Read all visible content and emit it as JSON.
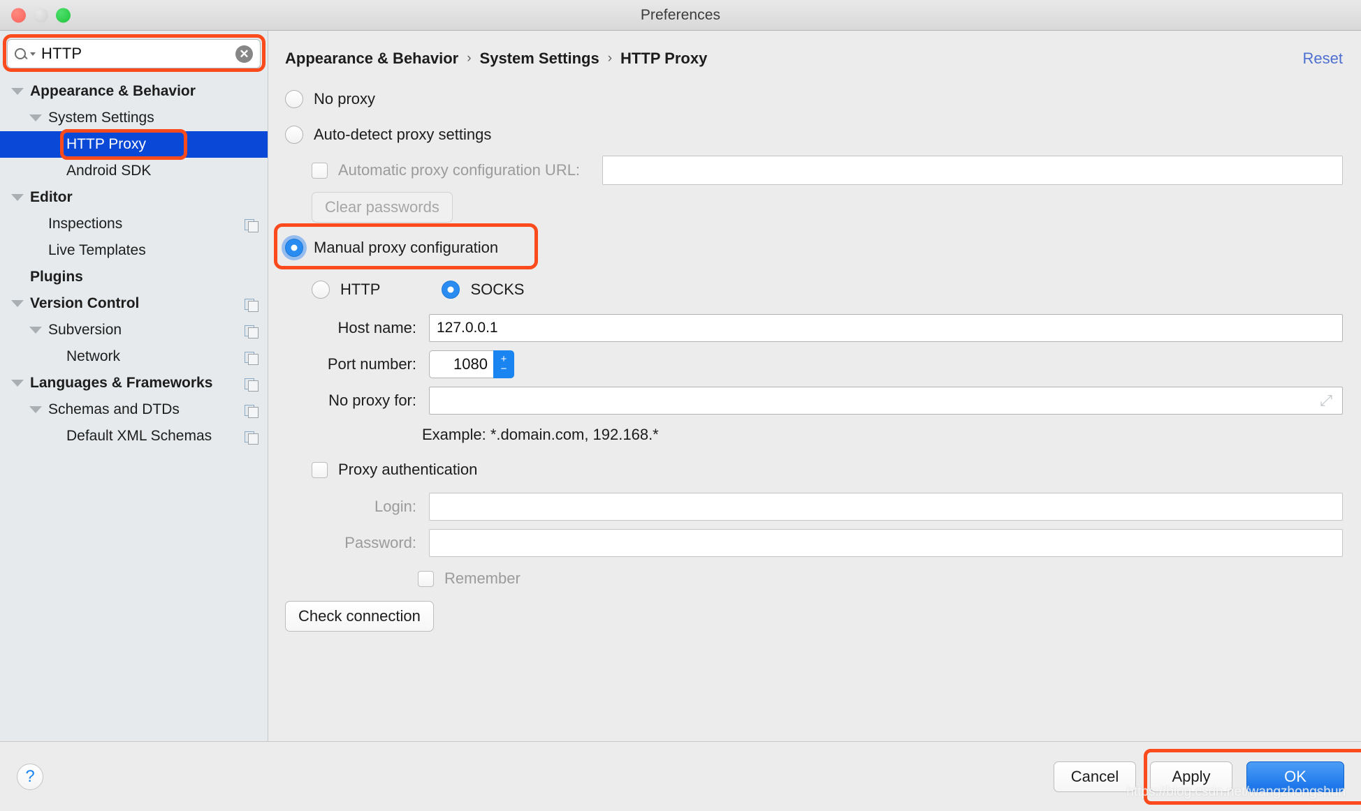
{
  "window": {
    "title": "Preferences",
    "traffic_lights": [
      "close",
      "minimize",
      "zoom"
    ]
  },
  "search": {
    "value": "HTTP",
    "placeholder": "",
    "icon": "search-icon",
    "clear_glyph": "✕"
  },
  "sidebar": {
    "items": [
      {
        "label": "Appearance & Behavior",
        "depth": 0,
        "bold": true,
        "twisty": true,
        "selected": false,
        "copy": false
      },
      {
        "label": "System Settings",
        "depth": 1,
        "bold": false,
        "twisty": true,
        "selected": false,
        "copy": false
      },
      {
        "label": "HTTP Proxy",
        "depth": 2,
        "bold": false,
        "twisty": false,
        "selected": true,
        "copy": false
      },
      {
        "label": "Android SDK",
        "depth": 2,
        "bold": false,
        "twisty": false,
        "selected": false,
        "copy": false
      },
      {
        "label": "Editor",
        "depth": 0,
        "bold": true,
        "twisty": true,
        "selected": false,
        "copy": false
      },
      {
        "label": "Inspections",
        "depth": 1,
        "bold": false,
        "twisty": false,
        "selected": false,
        "copy": true
      },
      {
        "label": "Live Templates",
        "depth": 1,
        "bold": false,
        "twisty": false,
        "selected": false,
        "copy": false
      },
      {
        "label": "Plugins",
        "depth": 0,
        "bold": true,
        "twisty": false,
        "selected": false,
        "copy": false
      },
      {
        "label": "Version Control",
        "depth": 0,
        "bold": true,
        "twisty": true,
        "selected": false,
        "copy": true
      },
      {
        "label": "Subversion",
        "depth": 1,
        "bold": false,
        "twisty": true,
        "selected": false,
        "copy": true
      },
      {
        "label": "Network",
        "depth": 2,
        "bold": false,
        "twisty": false,
        "selected": false,
        "copy": true
      },
      {
        "label": "Languages & Frameworks",
        "depth": 0,
        "bold": true,
        "twisty": true,
        "selected": false,
        "copy": true
      },
      {
        "label": "Schemas and DTDs",
        "depth": 1,
        "bold": false,
        "twisty": true,
        "selected": false,
        "copy": true
      },
      {
        "label": "Default XML Schemas",
        "depth": 2,
        "bold": false,
        "twisty": false,
        "selected": false,
        "copy": true
      }
    ]
  },
  "breadcrumb": {
    "parts": [
      "Appearance & Behavior",
      "System Settings",
      "HTTP Proxy"
    ],
    "separator": "›",
    "reset_label": "Reset"
  },
  "proxy": {
    "no_proxy_label": "No proxy",
    "no_proxy_selected": false,
    "auto_detect_label": "Auto-detect proxy settings",
    "auto_detect_selected": false,
    "pac_checkbox_label": "Automatic proxy configuration URL:",
    "pac_checked": false,
    "pac_url_value": "",
    "clear_passwords_label": "Clear passwords",
    "manual_label": "Manual proxy configuration",
    "manual_selected": true,
    "http_label": "HTTP",
    "http_selected": false,
    "socks_label": "SOCKS",
    "socks_selected": true,
    "host_label": "Host name:",
    "host_value": "127.0.0.1",
    "port_label": "Port number:",
    "port_value": "1080",
    "stepper_up": "+",
    "stepper_down": "−",
    "no_proxy_for_label": "No proxy for:",
    "no_proxy_for_value": "",
    "example_text": "Example: *.domain.com, 192.168.*",
    "expand_glyph": "⤢",
    "auth_checkbox_label": "Proxy authentication",
    "auth_checked": false,
    "login_label": "Login:",
    "login_value": "",
    "password_label": "Password:",
    "password_value": "",
    "remember_label": "Remember",
    "remember_checked": false,
    "check_connection_label": "Check connection"
  },
  "footer": {
    "help_glyph": "?",
    "cancel_label": "Cancel",
    "apply_label": "Apply",
    "ok_label": "OK"
  },
  "watermark": {
    "text": "https://blog.csdn.net/wangzhongshun"
  },
  "colors": {
    "highlight_orange": "#fb4a1b",
    "selection_blue": "#0a49d7",
    "accent_blue": "#1a85f0",
    "link_blue": "#4d6fcf",
    "sidebar_bg": "#e6eaec",
    "panel_bg": "#ececec"
  }
}
